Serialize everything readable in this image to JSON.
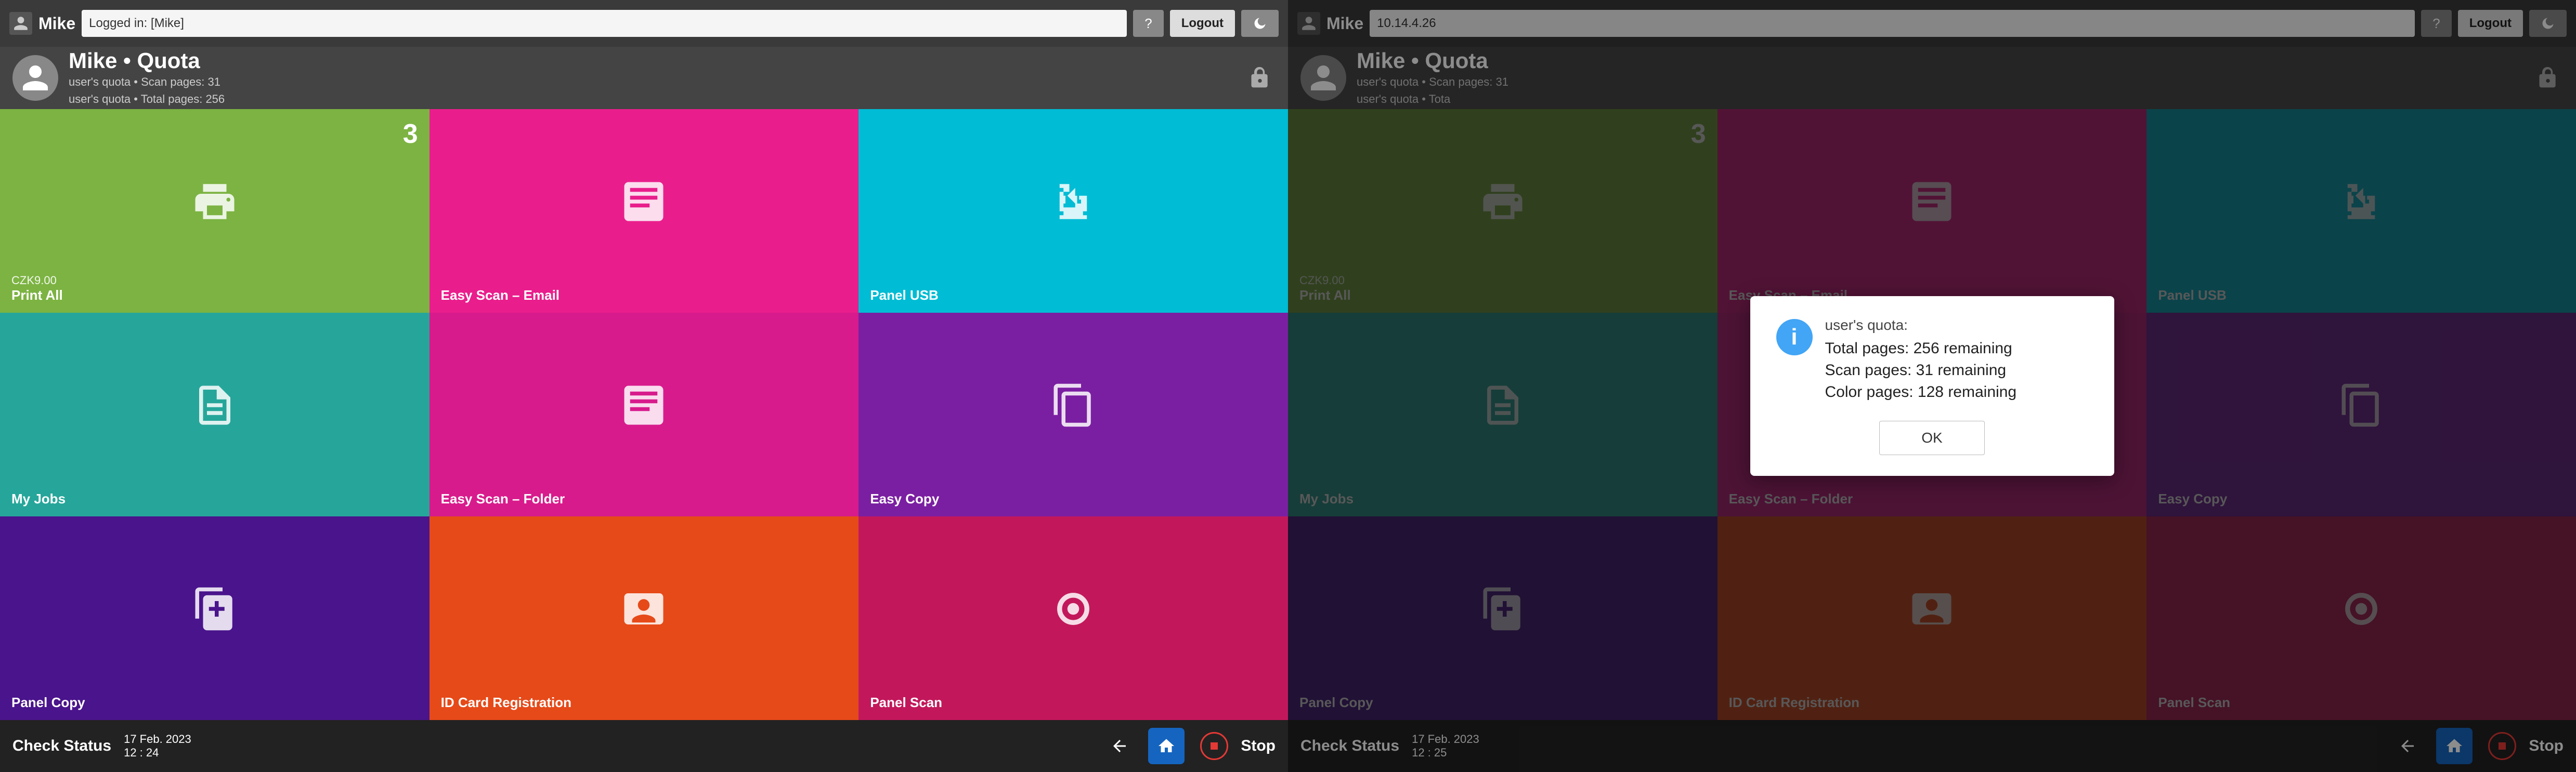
{
  "screen1": {
    "topbar": {
      "username": "Mike",
      "logged_in_label": "Logged in: [Mike]",
      "question_label": "?",
      "logout_label": "Logout",
      "moon_label": "🌙"
    },
    "userinfo": {
      "name": "Mike",
      "bullet": "•",
      "quota": "Quota",
      "sub1": "user's quota • Scan pages: 31",
      "sub2": "user's quota • Total pages: 256",
      "lock_icon": "🔒"
    },
    "tiles": [
      {
        "id": "print-all",
        "label": "Print All",
        "sublabel": "CZK9.00",
        "count": "3",
        "color": "tile-green",
        "icon": "printer"
      },
      {
        "id": "easy-scan-email",
        "label": "Easy Scan – Email",
        "sublabel": "",
        "count": "",
        "color": "tile-pink",
        "icon": "scanner"
      },
      {
        "id": "panel-usb",
        "label": "Panel USB",
        "sublabel": "",
        "count": "",
        "color": "tile-cyan",
        "icon": "usb"
      },
      {
        "id": "my-jobs",
        "label": "My Jobs",
        "sublabel": "",
        "count": "",
        "color": "tile-teal",
        "icon": "document"
      },
      {
        "id": "easy-scan-folder",
        "label": "Easy Scan – Folder",
        "sublabel": "",
        "count": "",
        "color": "tile-magenta",
        "icon": "scanner"
      },
      {
        "id": "easy-copy",
        "label": "Easy Copy",
        "sublabel": "",
        "count": "",
        "color": "tile-purple",
        "icon": "copy"
      },
      {
        "id": "panel-copy",
        "label": "Panel Copy",
        "sublabel": "",
        "count": "",
        "color": "tile-darkpurple",
        "icon": "panel-copy"
      },
      {
        "id": "id-card-reg",
        "label": "ID Card Registration",
        "sublabel": "",
        "count": "",
        "color": "tile-orange",
        "icon": "id-card"
      },
      {
        "id": "panel-scan",
        "label": "Panel Scan",
        "sublabel": "",
        "count": "",
        "color": "tile-darkpink",
        "icon": "panel-scan"
      }
    ],
    "bottombar": {
      "check_status": "Check Status",
      "date": "17 Feb. 2023",
      "time": "12 : 24",
      "stop": "Stop"
    }
  },
  "screen2": {
    "topbar": {
      "username": "Mike",
      "address": "10.14.4.26",
      "question_label": "?",
      "logout_label": "Logout",
      "moon_label": "🌙"
    },
    "userinfo": {
      "name": "Mike",
      "bullet": "•",
      "quota": "Quota",
      "sub1": "user's quota • Scan pages: 31",
      "sub2": "user's quota • Tota",
      "lock_icon": "🔒"
    },
    "modal": {
      "title": "user's quota:",
      "line1": "Total pages: 256 remaining",
      "line2": "Scan pages: 31 remaining",
      "line3": "Color pages: 128 remaining",
      "ok_label": "OK"
    },
    "bottombar": {
      "check_status": "Check Status",
      "date": "17 Feb. 2023",
      "time": "12 : 25",
      "stop": "Stop"
    }
  }
}
